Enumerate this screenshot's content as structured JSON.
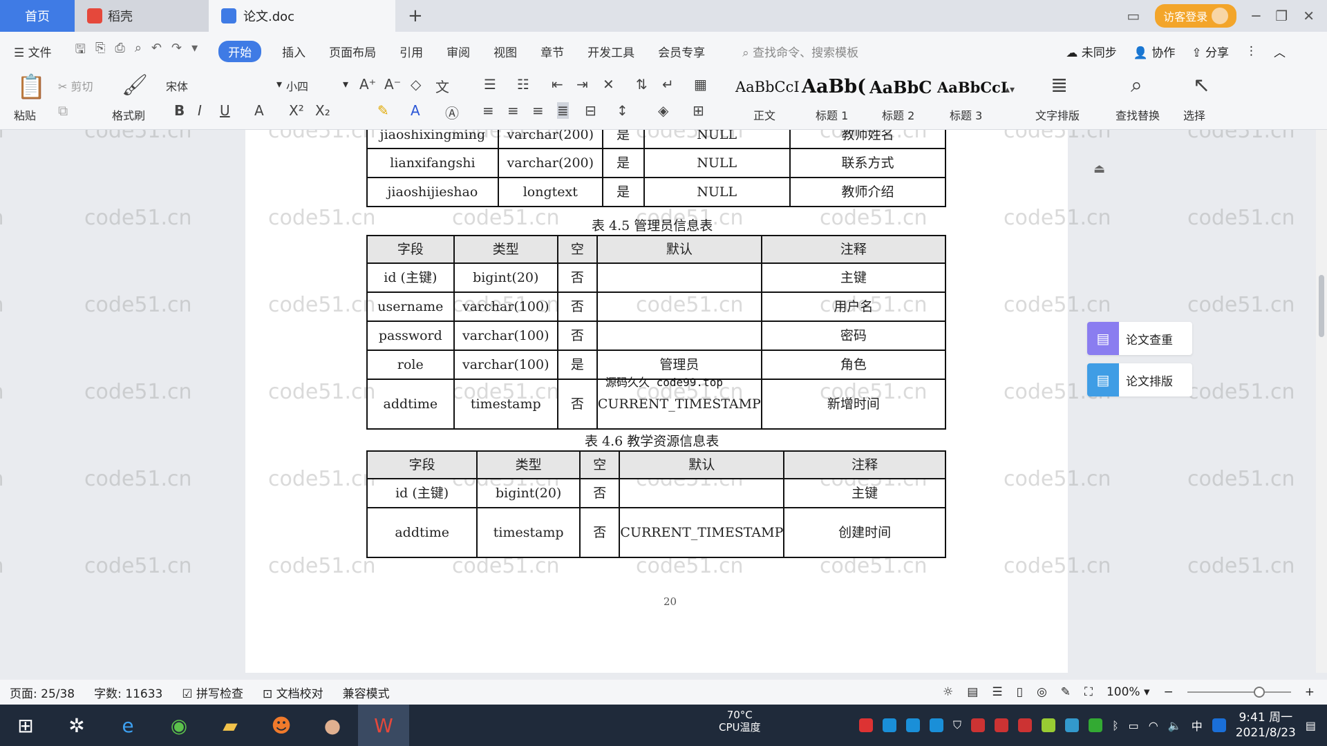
{
  "tabs": {
    "home": "首页",
    "daoke": "稻壳",
    "doc": "论文.doc",
    "visitor": "访客登录"
  },
  "menu": {
    "file": "文件",
    "items": [
      "开始",
      "插入",
      "页面布局",
      "引用",
      "审阅",
      "视图",
      "章节",
      "开发工具",
      "会员专享"
    ],
    "search": "查找命令、搜索模板",
    "sync": "未同步",
    "collab": "协作",
    "share": "分享"
  },
  "ribbon": {
    "paste": "粘贴",
    "cut": "剪切",
    "format_painter": "格式刷",
    "font": "宋体",
    "size": "小四",
    "styles": [
      {
        "sample": "AaBbCcI",
        "label": "正文"
      },
      {
        "sample": "AaBb(",
        "label": "标题 1"
      },
      {
        "sample": "AaBbC",
        "label": "标题 2"
      },
      {
        "sample": "AaBbCcI",
        "label": "标题 3"
      }
    ],
    "text_layout": "文字排版",
    "find_replace": "查找替换",
    "select": "选择"
  },
  "document": {
    "table_top": {
      "rows": [
        [
          "jiaoshixingming",
          "varchar(200)",
          "是",
          "NULL",
          "教师姓名"
        ],
        [
          "lianxifangshi",
          "varchar(200)",
          "是",
          "NULL",
          "联系方式"
        ],
        [
          "jiaoshijieshao",
          "longtext",
          "是",
          "NULL",
          "教师介绍"
        ]
      ]
    },
    "caption_45": "表 4.5  管理员信息表",
    "table_45": {
      "headers": [
        "字段",
        "类型",
        "空",
        "默认",
        "注释"
      ],
      "rows": [
        [
          "id (主键)",
          "bigint(20)",
          "否",
          "",
          "主键"
        ],
        [
          "username",
          "varchar(100)",
          "否",
          "",
          "用户名"
        ],
        [
          "password",
          "varchar(100)",
          "否",
          "",
          "密码"
        ],
        [
          "role",
          "varchar(100)",
          "是",
          "管理员",
          "角色"
        ],
        [
          "addtime",
          "timestamp",
          "否",
          "CURRENT_TIMESTAMP",
          "新增时间"
        ]
      ]
    },
    "overlay": "源码久久 code99.top",
    "caption_46": "表 4.6  教学资源信息表",
    "table_46": {
      "headers": [
        "字段",
        "类型",
        "空",
        "默认",
        "注释"
      ],
      "rows": [
        [
          "id (主键)",
          "bigint(20)",
          "否",
          "",
          "主键"
        ],
        [
          "addtime",
          "timestamp",
          "否",
          "CURRENT_TIMESTAMP",
          "创建时间"
        ]
      ]
    },
    "page_number": "20",
    "watermark": "code51.cn"
  },
  "side_panel": {
    "check": "论文查重",
    "layout": "论文排版"
  },
  "status": {
    "page": "页面: 25/38",
    "words": "字数: 11633",
    "spell": "拼写检查",
    "proof": "文档校对",
    "compat": "兼容模式",
    "zoom": "100%"
  },
  "taskbar": {
    "cpu_temp": "70°C",
    "cpu_label": "CPU温度",
    "ime": "中",
    "time": "9:41 周一",
    "date": "2021/8/23"
  }
}
